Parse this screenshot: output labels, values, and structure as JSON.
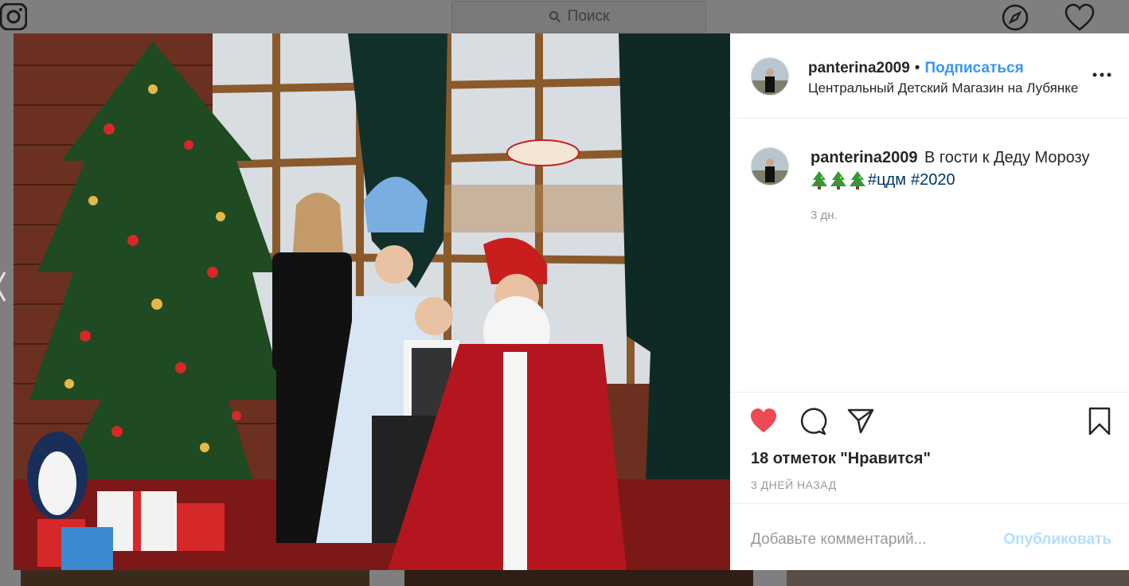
{
  "header": {
    "search_placeholder": "Поиск",
    "icons": [
      "instagram-icon",
      "search-icon",
      "compass-icon",
      "heart-icon"
    ]
  },
  "post": {
    "header": {
      "username": "panterina2009",
      "separator": "•",
      "follow_label": "Подписаться",
      "location": "Центральный Детский Магазин на Лубянке"
    },
    "caption": {
      "username": "panterina2009",
      "text": "В гости к Деду Морозу",
      "emoji": "christmas-tree-icon x3",
      "hashtags": [
        "#цдм",
        "#2020"
      ],
      "time": "3 дн."
    },
    "likes_text": "18 отметок \"Нравится\"",
    "date_text": "3 ДНЕЙ НАЗАД",
    "comment_placeholder": "Добавьте комментарий...",
    "publish_label": "Опубликовать",
    "liked": true
  },
  "colors": {
    "accent": "#3897f0",
    "like_red": "#ed4956",
    "hashtag": "#003569",
    "overlay": "#7f7f7f"
  }
}
